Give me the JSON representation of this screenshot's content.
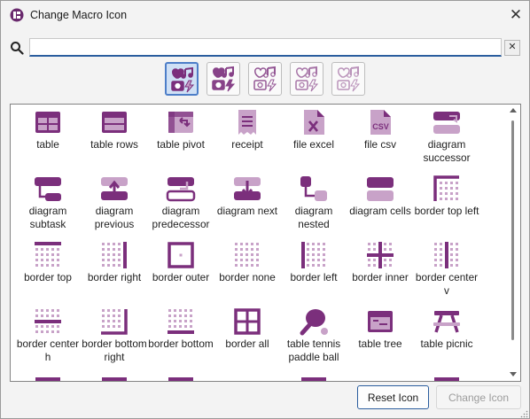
{
  "window": {
    "title": "Change Macro Icon",
    "close_glyph": "✕"
  },
  "search": {
    "value": "",
    "placeholder": "",
    "clear_glyph": "✕"
  },
  "colors": {
    "accent": "#7b2f7c",
    "light": "#c8a2c8",
    "selection": "#cfe0f5"
  },
  "style_buttons": [
    {
      "name": "style-solid",
      "selected": true
    },
    {
      "name": "style-solid-alt",
      "selected": false
    },
    {
      "name": "style-duotone",
      "selected": false
    },
    {
      "name": "style-outline",
      "selected": false
    },
    {
      "name": "style-thin",
      "selected": false
    }
  ],
  "icons": [
    {
      "label": "table",
      "icon": "table-icon"
    },
    {
      "label": "table rows",
      "icon": "table-rows-icon"
    },
    {
      "label": "table pivot",
      "icon": "table-pivot-icon"
    },
    {
      "label": "receipt",
      "icon": "receipt-icon"
    },
    {
      "label": "file excel",
      "icon": "file-excel-icon"
    },
    {
      "label": "file csv",
      "icon": "file-csv-icon"
    },
    {
      "label": "diagram successor",
      "icon": "diagram-successor-icon"
    },
    {
      "label": "diagram subtask",
      "icon": "diagram-subtask-icon"
    },
    {
      "label": "diagram previous",
      "icon": "diagram-previous-icon"
    },
    {
      "label": "diagram predecessor",
      "icon": "diagram-predecessor-icon"
    },
    {
      "label": "diagram next",
      "icon": "diagram-next-icon"
    },
    {
      "label": "diagram nested",
      "icon": "diagram-nested-icon"
    },
    {
      "label": "diagram cells",
      "icon": "diagram-cells-icon"
    },
    {
      "label": "border top left",
      "icon": "border-top-left-icon"
    },
    {
      "label": "border top",
      "icon": "border-top-icon"
    },
    {
      "label": "border right",
      "icon": "border-right-icon"
    },
    {
      "label": "border outer",
      "icon": "border-outer-icon"
    },
    {
      "label": "border none",
      "icon": "border-none-icon"
    },
    {
      "label": "border left",
      "icon": "border-left-icon"
    },
    {
      "label": "border inner",
      "icon": "border-inner-icon"
    },
    {
      "label": "border center v",
      "icon": "border-center-v-icon"
    },
    {
      "label": "border center h",
      "icon": "border-center-h-icon"
    },
    {
      "label": "border bottom right",
      "icon": "border-bottom-right-icon"
    },
    {
      "label": "border bottom",
      "icon": "border-bottom-icon"
    },
    {
      "label": "border all",
      "icon": "border-all-icon"
    },
    {
      "label": "table tennis paddle ball",
      "icon": "table-tennis-paddle-ball-icon"
    },
    {
      "label": "table tree",
      "icon": "table-tree-icon"
    },
    {
      "label": "table picnic",
      "icon": "table-picnic-icon"
    }
  ],
  "buttons": {
    "reset": "Reset Icon",
    "change": "Change Icon"
  }
}
